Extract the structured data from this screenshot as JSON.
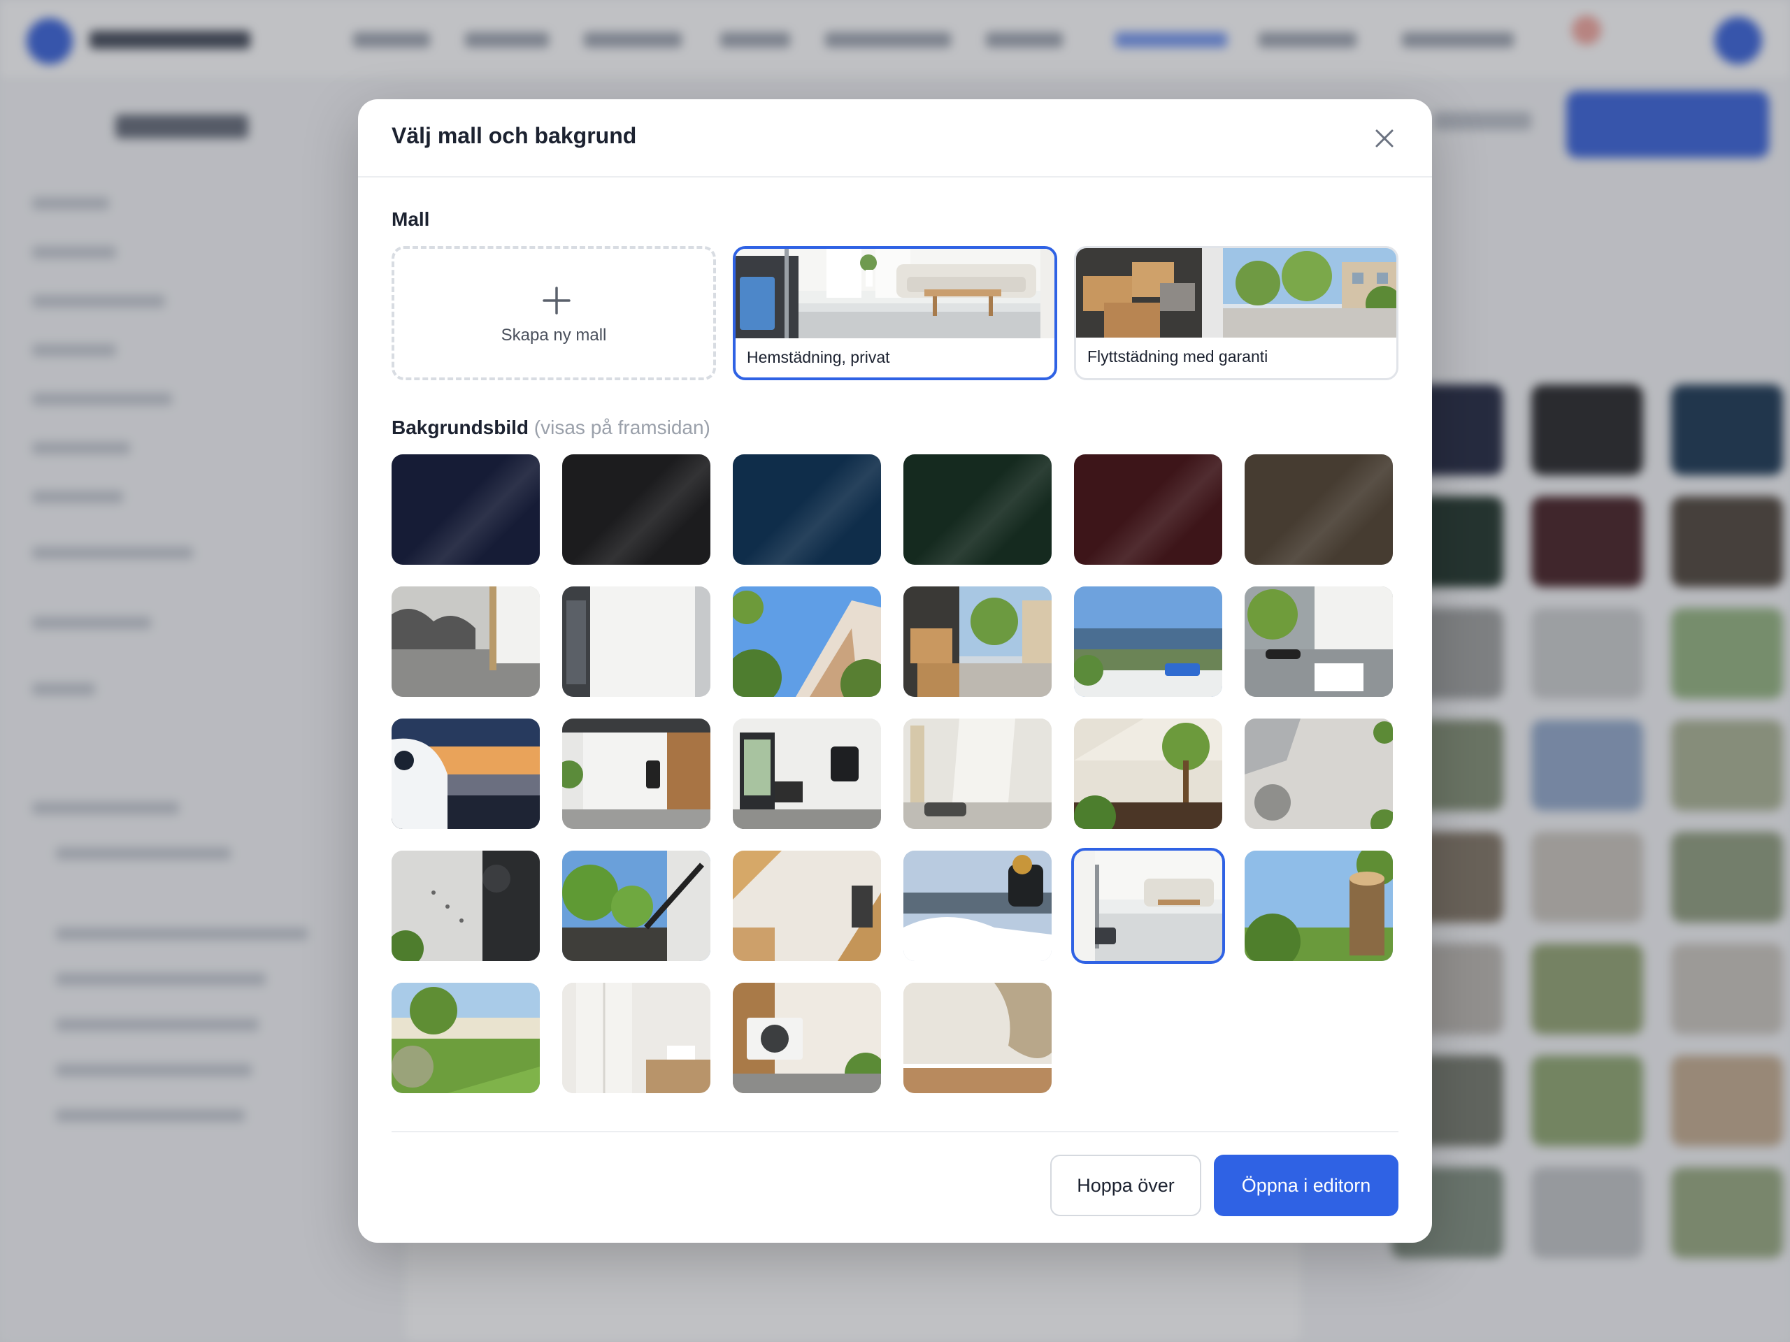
{
  "modal": {
    "title": "Välj mall och bakgrund",
    "close_icon": "close-icon",
    "template_section": {
      "label": "Mall",
      "new_template_label": "Skapa ny mall",
      "templates": [
        {
          "label": "Hemstädning, privat",
          "selected": true
        },
        {
          "label": "Flyttstädning med garanti",
          "selected": false
        }
      ]
    },
    "background_section": {
      "label": "Bakgrundsbild",
      "hint": "(visas på framsidan)",
      "selected_index": 22,
      "tiles": [
        {
          "kind": "color",
          "color": "#161c36"
        },
        {
          "kind": "color",
          "color": "#1c1c1e"
        },
        {
          "kind": "color",
          "color": "#0f2d4a"
        },
        {
          "kind": "color",
          "color": "#152a1f"
        },
        {
          "kind": "color",
          "color": "#3d1519"
        },
        {
          "kind": "color",
          "color": "#463c31"
        },
        {
          "kind": "photo",
          "subject": "mold-floor"
        },
        {
          "kind": "photo",
          "subject": "electrical-cabinet"
        },
        {
          "kind": "photo",
          "subject": "apartment-sky"
        },
        {
          "kind": "photo",
          "subject": "moving-boxes"
        },
        {
          "kind": "photo",
          "subject": "window-lake"
        },
        {
          "kind": "photo",
          "subject": "inspection-tools"
        },
        {
          "kind": "photo",
          "subject": "van-sunset"
        },
        {
          "kind": "photo",
          "subject": "ev-charger-wall"
        },
        {
          "kind": "photo",
          "subject": "hallway-alarm"
        },
        {
          "kind": "photo",
          "subject": "painting-room"
        },
        {
          "kind": "photo",
          "subject": "tree-planting"
        },
        {
          "kind": "photo",
          "subject": "tiles-drain"
        },
        {
          "kind": "photo",
          "subject": "pest-tracks"
        },
        {
          "kind": "photo",
          "subject": "pressure-washer"
        },
        {
          "kind": "photo",
          "subject": "carpentry"
        },
        {
          "kind": "photo",
          "subject": "snow-blower"
        },
        {
          "kind": "photo",
          "subject": "living-room-mop"
        },
        {
          "kind": "photo",
          "subject": "tree-stump"
        },
        {
          "kind": "photo",
          "subject": "garden-lawn"
        },
        {
          "kind": "photo",
          "subject": "bathroom"
        },
        {
          "kind": "photo",
          "subject": "heat-pump"
        },
        {
          "kind": "photo",
          "subject": "water-damage"
        }
      ]
    },
    "footer": {
      "skip_label": "Hoppa över",
      "open_label": "Öppna i editorn"
    }
  },
  "colors": {
    "accent": "#2f62e4",
    "title": "#1c2230",
    "hint": "#9aa0aa"
  }
}
